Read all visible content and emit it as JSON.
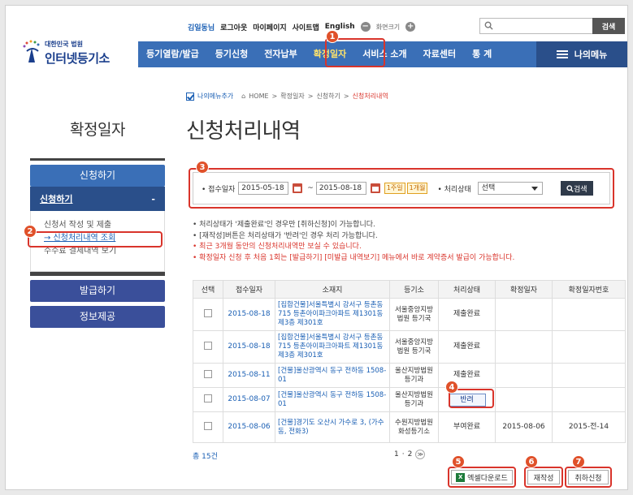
{
  "header": {
    "logo_small": "대한민국 법원",
    "logo_big": "인터넷등기소",
    "user_name": "김일동님",
    "util_links": [
      "로그아웃",
      "마이페이지",
      "사이트맵",
      "English"
    ],
    "font_size_label": "화면크기",
    "search_placeholder": "",
    "search_button": "검색"
  },
  "gnb": {
    "items": [
      "등기열람/발급",
      "등기신청",
      "전자납부",
      "확정일자",
      "서비스 소개",
      "자료센터",
      "통 계"
    ],
    "my_menu": "나의메뉴"
  },
  "breadcrumb": {
    "add_my_menu": "나의메뉴추가",
    "path": [
      "HOME",
      "확정일자",
      "신청하기"
    ],
    "current": "신청처리내역"
  },
  "left_title": "확정일자",
  "page_title": "신청처리내역",
  "lnb": {
    "section1": "신청하기",
    "sub_header": "신청하기",
    "sub_toggle": "-",
    "sub_items": [
      "신청서 작성 및 제출",
      "→ 신청처리내역 조회",
      "수수료 결제내역 보기"
    ],
    "section2": "발급하기",
    "section3": "정보제공"
  },
  "search": {
    "date_label": "• 접수일자",
    "date_from": "2015-05-18",
    "date_to": "2015-08-18",
    "week_btn": "1주일",
    "month_btn": "1개월",
    "status_label": "• 처리상태",
    "status_value": "선택",
    "query_btn": "검색"
  },
  "notes": [
    "• 처리상태가 '제출완료'인 경우만 [취하신청]이 가능합니다.",
    "• [재작성]버튼은 처리상태가 '반려'인 경우 처리 가능합니다.",
    "• 최근 3개월 동안의 신청처리내역만 보실 수 있습니다.",
    "• 확정일자 신청 후 처음 1회는 [발급하기] [미발급 내역보기] 메뉴에서 바로 계약증서 발급이 가능합니다."
  ],
  "table": {
    "headers": [
      "선택",
      "접수일자",
      "소재지",
      "등기소",
      "처리상태",
      "확정일자",
      "확정일자번호"
    ],
    "rows": [
      {
        "date": "2015-08-18",
        "addr": "[집합건물]서울특별시 강서구 등촌동 715 등촌아이파크아파트 제1301동 제3층 제301호",
        "office": "서울중앙지방법원 등기국",
        "status": "제출완료",
        "confirm_date": "",
        "confirm_no": ""
      },
      {
        "date": "2015-08-18",
        "addr": "[집합건물]서울특별시 강서구 등촌동 715 등촌아이파크아파트 제1301동 제3층 제301호",
        "office": "서울중앙지방법원 등기국",
        "status": "제출완료",
        "confirm_date": "",
        "confirm_no": ""
      },
      {
        "date": "2015-08-11",
        "addr": "[건물]울산광역시 동구 전하동 1508-01",
        "office": "울산지방법원 등기과",
        "status": "제출완료",
        "confirm_date": "",
        "confirm_no": ""
      },
      {
        "date": "2015-08-07",
        "addr": "[건물]울산광역시 동구 전하동 1508-01",
        "office": "울산지방법원 등기과",
        "status": "반려",
        "confirm_date": "",
        "confirm_no": ""
      },
      {
        "date": "2015-08-06",
        "addr": "[건물]경기도 오산시 가수로 3, (가수동, 전화3)",
        "office": "수원지방법원 화성등기소",
        "status": "부여완료",
        "confirm_date": "2015-08-06",
        "confirm_no": "2015-전-14"
      }
    ]
  },
  "footer": {
    "total": "총 15건",
    "pages": [
      "1",
      "2"
    ],
    "next": "≫",
    "excel_btn": "엑셀다운로드",
    "rewrite_btn": "재작성",
    "cancel_btn": "취하신청"
  },
  "badges": [
    "1",
    "2",
    "3",
    "4",
    "5",
    "6",
    "7"
  ],
  "colors": {
    "nav": "#3a6fb7",
    "nav_dark": "#2a4f8a",
    "highlight": "#d9342b",
    "badge": "#e0512a"
  }
}
